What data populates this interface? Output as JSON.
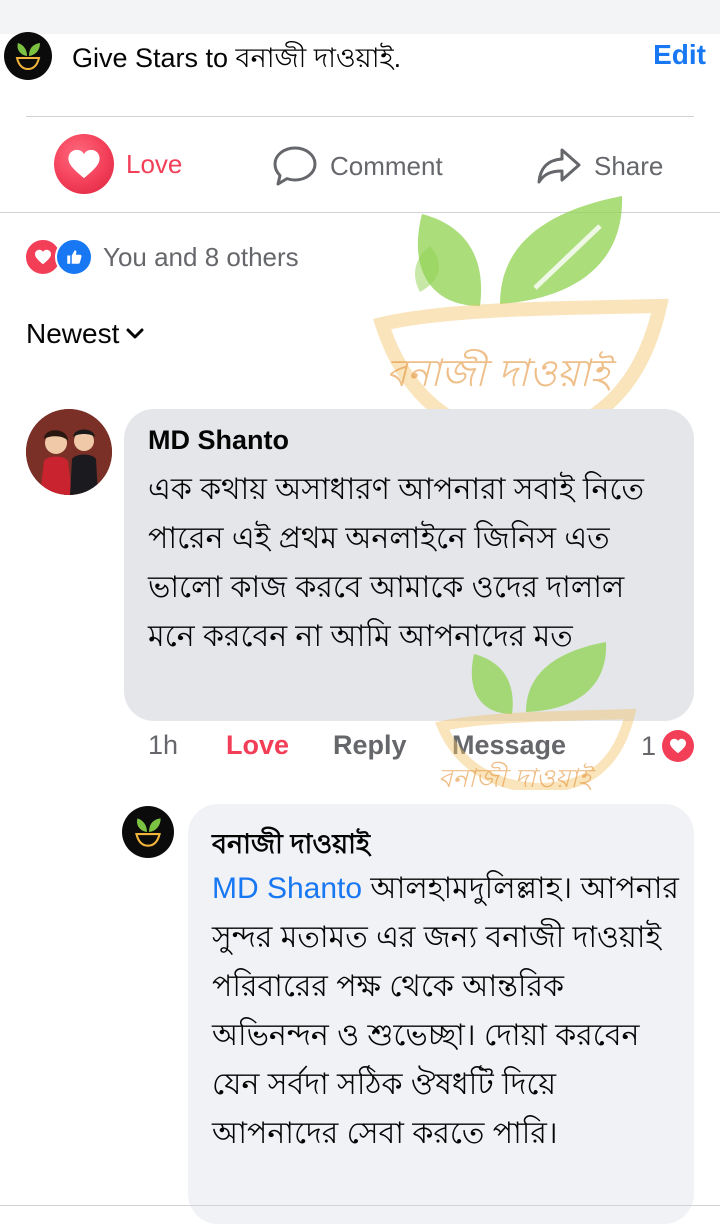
{
  "post_actions": {
    "give_stars_text": "Give Stars to বনাজী দাওয়াই.",
    "edit_label": "Edit",
    "love_label": "Love",
    "comment_label": "Comment",
    "share_label": "Share"
  },
  "reactions": {
    "summary": "You and 8 others"
  },
  "sort": {
    "label": "Newest"
  },
  "comment": {
    "author": "MD Shanto",
    "text": "এক কথায় অসাধারণ আপনারা সবাই নিতে পারেন এই প্রথম অনলাইনে জিনিস এত ভালো কাজ করবে আমাকে ওদের দালাল মনে করবেন না আমি আপনাদের মত",
    "time": "1h",
    "love_action": "Love",
    "reply_action": "Reply",
    "message_action": "Message",
    "reaction_count": "1"
  },
  "reply": {
    "author": "বনাজী দাওয়াই",
    "mention": "MD Shanto",
    "text": "আলহামদুলিল্লাহ। আপনার সুন্দর মতামত এর জন্য বনাজী দাওয়াই পরিবারের পক্ষ থেকে আন্তরিক অভিনন্দন ও শুভেচ্ছা। দোয়া করবেন যেন সর্বদা সঠিক ঔষধটি দিয়ে আপনাদের সেবা করতে পারি।"
  },
  "watermark": {
    "text": "বনাজী দাওয়াই"
  },
  "colors": {
    "accent_blue": "#1877f2",
    "love_red": "#f33e58",
    "bubble_gray": "#e4e6ea",
    "secondary_text": "#65676b"
  }
}
